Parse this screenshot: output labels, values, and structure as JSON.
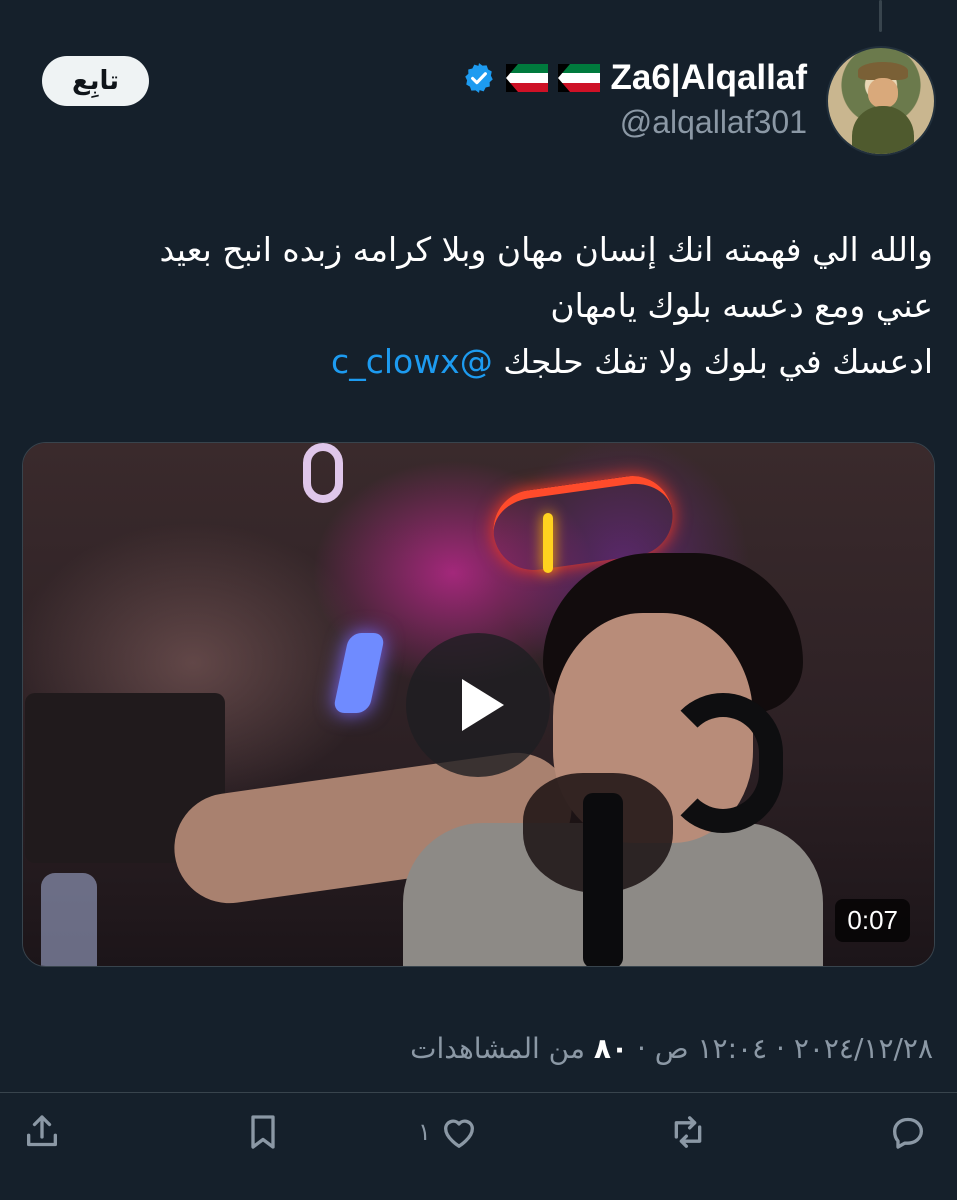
{
  "author": {
    "display_name": "Za6|Alqallaf",
    "handle": "@alqallaf301",
    "flags": [
      "kuwait-flag",
      "kuwait-flag"
    ],
    "verified": true
  },
  "follow_button": {
    "label": "تابِع"
  },
  "tweet": {
    "line1": "والله الي فهمته انك إنسان مهان وبلا كرامه زبده انبح بعيد",
    "line2": "عني ومع دعسه بلوك يامهان",
    "line3_text": "ادعسك في بلوك ولا تفك حلجك",
    "mention": "@c_clowx"
  },
  "media": {
    "type": "video",
    "duration": "0:07",
    "play_icon": "play-icon"
  },
  "meta": {
    "date_time": "٢٠٢٤/١٢/٢٨ · ١٢:٠٤ ص · ",
    "views_count": "٨٠",
    "views_label": " من المشاهدات"
  },
  "actions": {
    "reply_icon": "reply-icon",
    "retweet_icon": "retweet-icon",
    "like_icon": "heart-icon",
    "like_count": "١",
    "bookmark_icon": "bookmark-icon",
    "share_icon": "share-icon"
  },
  "colors": {
    "background": "#15202b",
    "link": "#1d9bf0",
    "muted": "#8b98a5",
    "verified": "#1d9bf0"
  }
}
